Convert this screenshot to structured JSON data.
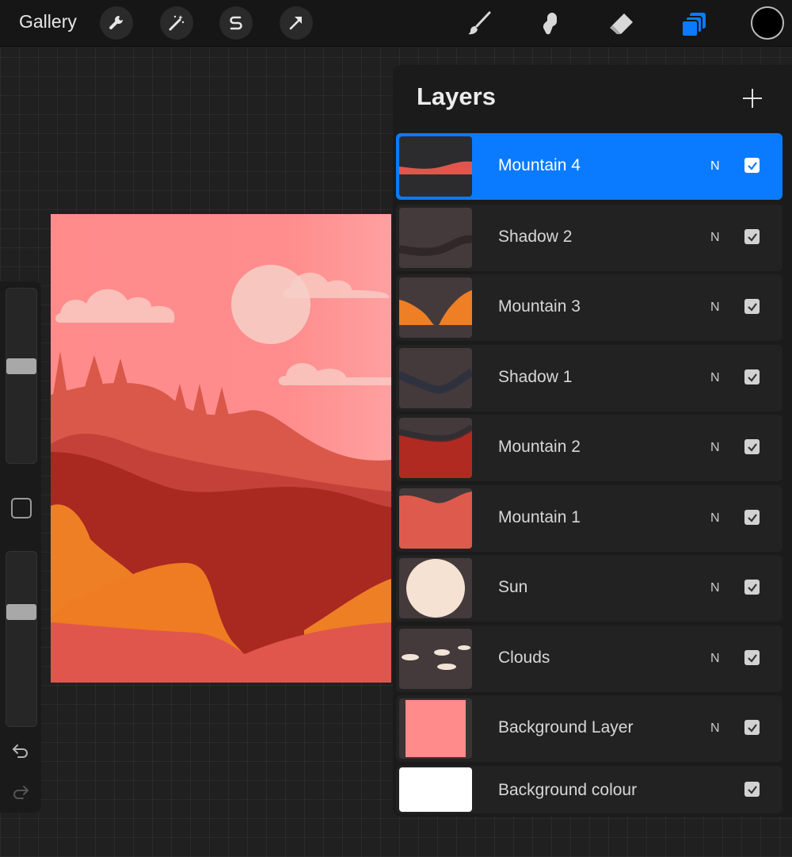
{
  "app": {
    "gallery_label": "Gallery"
  },
  "toolbar": {
    "left_tools": [
      "wrench-icon",
      "magic-wand-icon",
      "selection-s-icon",
      "arrow-transform-icon"
    ],
    "right_tools": [
      "brush-icon",
      "smudge-icon",
      "eraser-icon",
      "layers-icon"
    ],
    "current_color": "#000000",
    "accent_color": "#0a7bff"
  },
  "layers": {
    "title": "Layers",
    "add_label": "+",
    "items": [
      {
        "name": "Mountain 4",
        "blend": "N",
        "visible": true,
        "selected": true
      },
      {
        "name": "Shadow 2",
        "blend": "N",
        "visible": true
      },
      {
        "name": "Mountain 3",
        "blend": "N",
        "visible": true
      },
      {
        "name": "Shadow 1",
        "blend": "N",
        "visible": true
      },
      {
        "name": "Mountain 2",
        "blend": "N",
        "visible": true
      },
      {
        "name": "Mountain 1",
        "blend": "N",
        "visible": true
      },
      {
        "name": "Sun",
        "blend": "N",
        "visible": true
      },
      {
        "name": "Clouds",
        "blend": "N",
        "visible": true
      },
      {
        "name": "Background Layer",
        "blend": "N",
        "visible": true
      },
      {
        "name": "Background colour",
        "blend": "",
        "visible": true
      }
    ]
  },
  "sidebar": {
    "icons": [
      "undo-icon",
      "redo-icon",
      "modify-square-icon"
    ]
  }
}
